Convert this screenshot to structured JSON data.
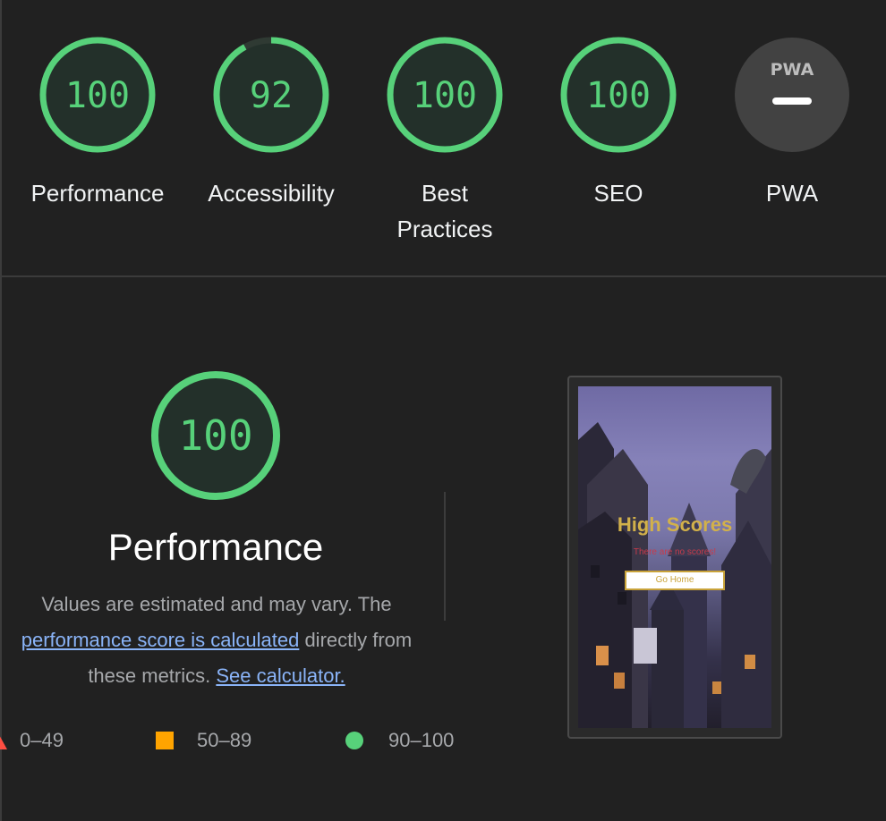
{
  "summary_gauges": [
    {
      "score": "100",
      "label_lines": [
        "Performance"
      ],
      "color": "#57d17a",
      "fraction": 1.0
    },
    {
      "score": "92",
      "label_lines": [
        "Accessibility"
      ],
      "color": "#57d17a",
      "fraction": 0.92
    },
    {
      "score": "100",
      "label_lines": [
        "Best",
        "Practices"
      ],
      "color": "#57d17a",
      "fraction": 1.0
    },
    {
      "score": "100",
      "label_lines": [
        "SEO"
      ],
      "color": "#57d17a",
      "fraction": 1.0
    }
  ],
  "pwa": {
    "badge_text": "PWA",
    "label": "PWA",
    "badge_color": "#424242"
  },
  "performance": {
    "score": "100",
    "fraction": 1.0,
    "title": "Performance",
    "desc_pre": "Values are estimated and may vary. The ",
    "desc_link1": "performance score is calculated",
    "desc_mid": " directly from these metrics. ",
    "desc_link2": "See calculator."
  },
  "legend": {
    "range_fail": "0–49",
    "range_average": "50–89",
    "range_pass": "90–100",
    "colors": {
      "fail": "#ff4e42",
      "average": "#ffa400",
      "pass": "#57d17a"
    }
  },
  "screenshot": {
    "title": "High Scores",
    "subtitle": "There are no scores!",
    "button_label": "Go Home"
  }
}
